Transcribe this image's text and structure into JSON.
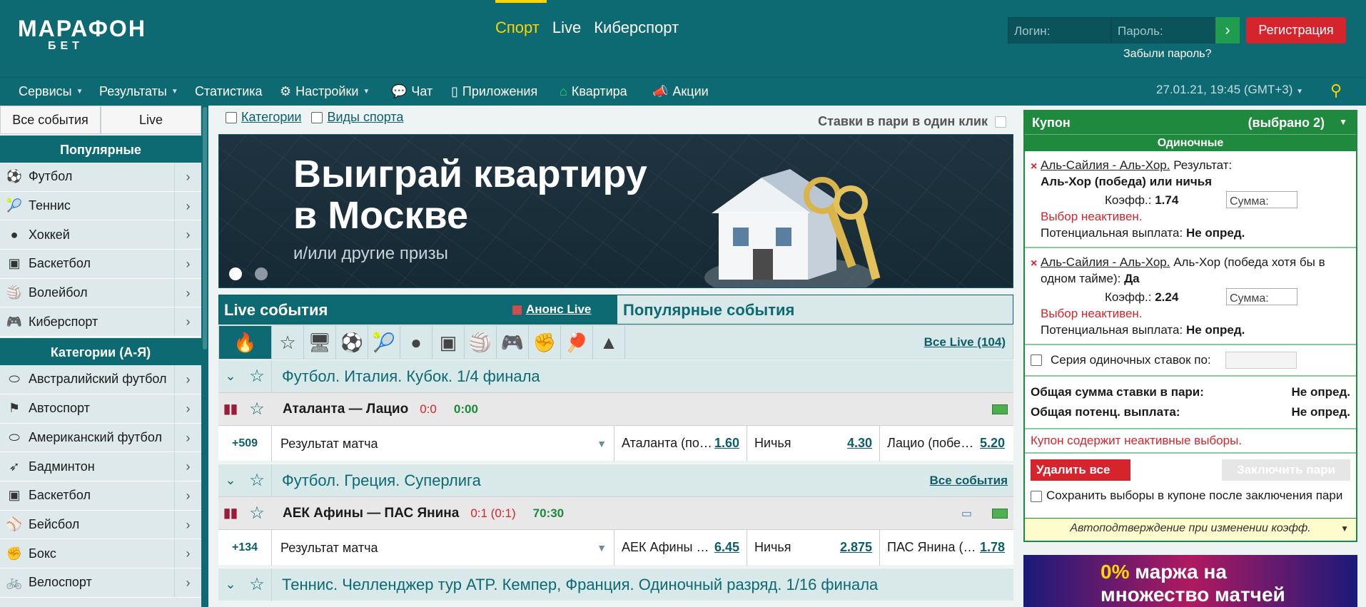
{
  "logo": {
    "line1": "МАРАФОН",
    "line2": "БЕТ"
  },
  "topnav": [
    "Спорт",
    "Live",
    "Киберспорт"
  ],
  "login": {
    "login_placeholder": "Логин:",
    "password_placeholder": "Пароль:",
    "go": "›",
    "register": "Регистрация",
    "forgot": "Забыли пароль?"
  },
  "menu": {
    "items": [
      {
        "label": "Сервисы",
        "icon": "",
        "caret": true
      },
      {
        "label": "Результаты",
        "icon": "",
        "caret": true
      },
      {
        "label": "Статистика",
        "icon": ""
      },
      {
        "label": "Настройки",
        "icon": "⚙",
        "caret": true
      },
      {
        "label": "Чат",
        "icon": "💬"
      },
      {
        "label": "Приложения",
        "icon": "▯"
      },
      {
        "label": "Квартира",
        "icon": "⌂"
      },
      {
        "label": "Акции",
        "icon": "📣"
      }
    ],
    "datetime": "27.01.21, 19:45 (GMT+3)"
  },
  "sidebar": {
    "tabs": [
      "Все события",
      "Live"
    ],
    "popular_title": "Популярные",
    "popular": [
      {
        "label": "Футбол",
        "icon": "⚽"
      },
      {
        "label": "Теннис",
        "icon": "🎾"
      },
      {
        "label": "Хоккей",
        "icon": "●"
      },
      {
        "label": "Баскетбол",
        "icon": "▣"
      },
      {
        "label": "Волейбол",
        "icon": "🏐"
      },
      {
        "label": "Киберспорт",
        "icon": "🎮"
      }
    ],
    "categories_title": "Категории (А-Я)",
    "categories": [
      {
        "label": "Австралийский футбол",
        "icon": "⬭"
      },
      {
        "label": "Автоспорт",
        "icon": "⚑"
      },
      {
        "label": "Американский футбол",
        "icon": "⬭"
      },
      {
        "label": "Бадминтон",
        "icon": "➶"
      },
      {
        "label": "Баскетбол",
        "icon": "▣"
      },
      {
        "label": "Бейсбол",
        "icon": "⚾"
      },
      {
        "label": "Бокс",
        "icon": "✊"
      },
      {
        "label": "Велоспорт",
        "icon": "🚲"
      }
    ]
  },
  "filters": {
    "categories": "Категории",
    "sports": "Виды спорта",
    "one_click": "Ставки в пари в один клик"
  },
  "banner": {
    "title": "Выиграй квартиру в Москве",
    "subtitle": "и/или другие призы"
  },
  "tabs": {
    "live": "Live события",
    "anons": "Анонс Live",
    "popular": "Популярные события",
    "all_live": "Все Live (104)"
  },
  "sports_icons": [
    "🔥",
    "☆",
    "🖥",
    "⚽",
    "🎾",
    "●",
    "▣",
    "🏐",
    "🎮",
    "✊",
    "🏓",
    "▲"
  ],
  "events": [
    {
      "league": "Футбол. Италия. Кубок. 1/4 финала",
      "all_events": "",
      "match": "Аталанта — Лацио",
      "score": "0:0",
      "time": "0:00",
      "count": "+509",
      "market": "Результат матча",
      "odds": [
        {
          "label": "Аталанта (по…",
          "value": "1.60"
        },
        {
          "label": "Ничья",
          "value": "4.30"
        },
        {
          "label": "Лацио (побе…",
          "value": "5.20"
        }
      ]
    },
    {
      "league": "Футбол. Греция. Суперлига",
      "all_events": "Все события",
      "match": "АЕК Афины — ПАС Янина",
      "score": "0:1 (0:1)",
      "time": "70:30",
      "count": "+134",
      "market": "Результат матча",
      "odds": [
        {
          "label": "АЕК Афины …",
          "value": "6.45"
        },
        {
          "label": "Ничья",
          "value": "2.875"
        },
        {
          "label": "ПАС Янина (…",
          "value": "1.78"
        }
      ]
    },
    {
      "league": "Теннис. Челленджер тур ATP. Кемпер, Франция. Одиночный разряд. 1/16 финала"
    }
  ],
  "coupon": {
    "title": "Купон",
    "selected": "(выбрано 2)",
    "single": "Одиночные",
    "bets": [
      {
        "event": "Аль-Сайлия - Аль-Хор.",
        "market": "Результат:",
        "pick": "Аль-Хор (победа) или ничья",
        "coef_label": "Коэфф.:",
        "coef": "1.74",
        "sum_placeholder": "Сумма:",
        "inactive": "Выбор неактивен.",
        "payout_label": "Потенциальная выплата:",
        "payout": "Не опред."
      },
      {
        "event": "Аль-Сайлия - Аль-Хор.",
        "market": "Аль-Хор (победа хотя бы в одном тайме):",
        "pick": "Да",
        "coef_label": "Коэфф.:",
        "coef": "2.24",
        "sum_placeholder": "Сумма:",
        "inactive": "Выбор неактивен.",
        "payout_label": "Потенциальная выплата:",
        "payout": "Не опред."
      }
    ],
    "series": "Серия одиночных ставок по:",
    "total_stake_label": "Общая сумма ставки в пари:",
    "total_stake": "Не опред.",
    "total_payout_label": "Общая потенц. выплата:",
    "total_payout": "Не опред.",
    "warning": "Купон содержит неактивные выборы.",
    "delete_all": "Удалить все",
    "place_bet": "Заключить пари",
    "keep": "Сохранить выборы в купоне после заключения пари",
    "autoconfirm": "Автоподтверждение при изменении коэфф."
  },
  "promo": {
    "pct": "0%",
    "line1": "маржа на",
    "line2": "множество матчей"
  },
  "colors": {
    "brand": "#0d6a73",
    "accent": "#ffd400",
    "danger": "#d6242c",
    "coupon": "#1f8a3e"
  }
}
